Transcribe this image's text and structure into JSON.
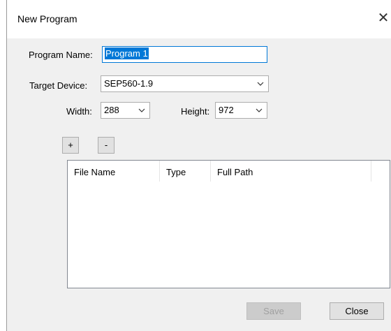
{
  "window": {
    "title": "New Program"
  },
  "form": {
    "program_name_label": "Program Name:",
    "program_name_value": "Program 1",
    "target_device_label": "Target Device:",
    "target_device_value": "SEP560-1.9",
    "width_label": "Width:",
    "width_value": "288",
    "height_label": "Height:",
    "height_value": "972"
  },
  "toolbar": {
    "add_label": "+",
    "remove_label": "-"
  },
  "table": {
    "columns": [
      "File Name",
      "Type",
      "Full Path"
    ],
    "rows": []
  },
  "footer": {
    "save_label": "Save",
    "save_enabled": false,
    "close_label": "Close"
  },
  "icons": {
    "close": "close-icon",
    "dropdown": "chevron-down-icon"
  },
  "colors": {
    "selection": "#0078d7",
    "dialog_bg": "#f0f0f0",
    "focus_border": "#0078d7"
  }
}
